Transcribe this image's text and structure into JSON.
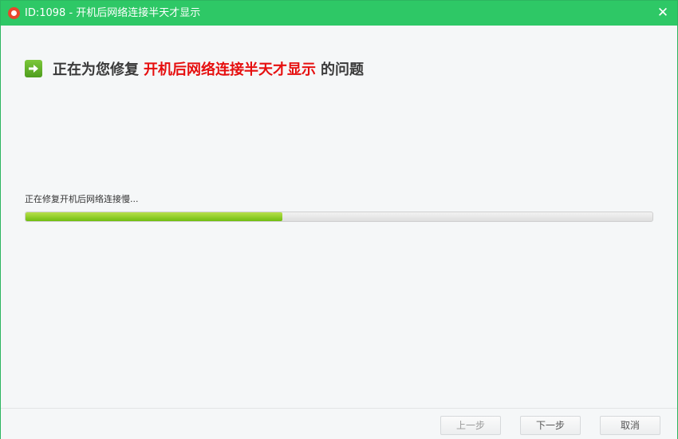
{
  "window": {
    "title": "ID:1098 - 开机后网络连接半天才显示",
    "close_glyph": "✕"
  },
  "heading": {
    "prefix": "正在为您修复",
    "issue": "开机后网络连接半天才显示",
    "suffix": "的问题"
  },
  "status": {
    "text": "正在修复开机后网络连接慢...",
    "progress": 0.41
  },
  "footer": {
    "prev_label": "上一步",
    "next_label": "下一步",
    "cancel_label": "取消"
  },
  "colors": {
    "titlebar": "#2ec866",
    "highlight": "#e60f0f",
    "progress": "#8ccc22"
  },
  "icons": [
    "app-logo-icon",
    "close-icon",
    "arrow-right-icon"
  ]
}
